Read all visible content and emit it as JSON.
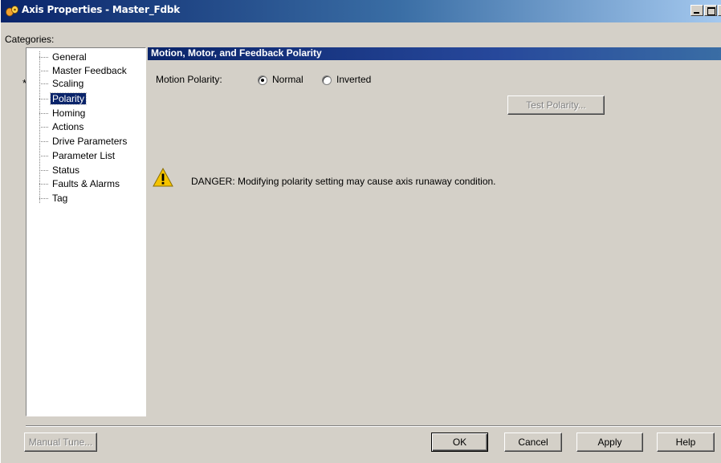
{
  "window": {
    "title": "Axis Properties - Master_Fdbk"
  },
  "categories": {
    "label": "Categories:",
    "items": [
      {
        "label": "General"
      },
      {
        "label": "Master Feedback"
      },
      {
        "label": "Scaling"
      },
      {
        "label": "Polarity",
        "selected": true
      },
      {
        "label": "Homing"
      },
      {
        "label": "Actions"
      },
      {
        "label": "Drive Parameters"
      },
      {
        "label": "Parameter List"
      },
      {
        "label": "Status"
      },
      {
        "label": "Faults & Alarms"
      },
      {
        "label": "Tag"
      }
    ],
    "modified_marker": "*"
  },
  "panel": {
    "header": "Motion, Motor, and Feedback Polarity",
    "motion_polarity_label": "Motion Polarity:",
    "options": [
      {
        "label": "Normal",
        "checked": true
      },
      {
        "label": "Inverted",
        "checked": false
      }
    ],
    "test_polarity_button": "Test Polarity...",
    "warning": "DANGER: Modifying polarity setting may cause axis runaway condition.",
    "warning_icon": "warning-triangle-icon"
  },
  "footer": {
    "manual_tune": "Manual Tune...",
    "ok": "OK",
    "cancel": "Cancel",
    "apply": "Apply",
    "help": "Help"
  },
  "colors": {
    "titlebar": "#0a246a",
    "dialog_bg": "#d4d0c8",
    "selection": "#0a246a",
    "warning_yellow": "#f5c400"
  }
}
